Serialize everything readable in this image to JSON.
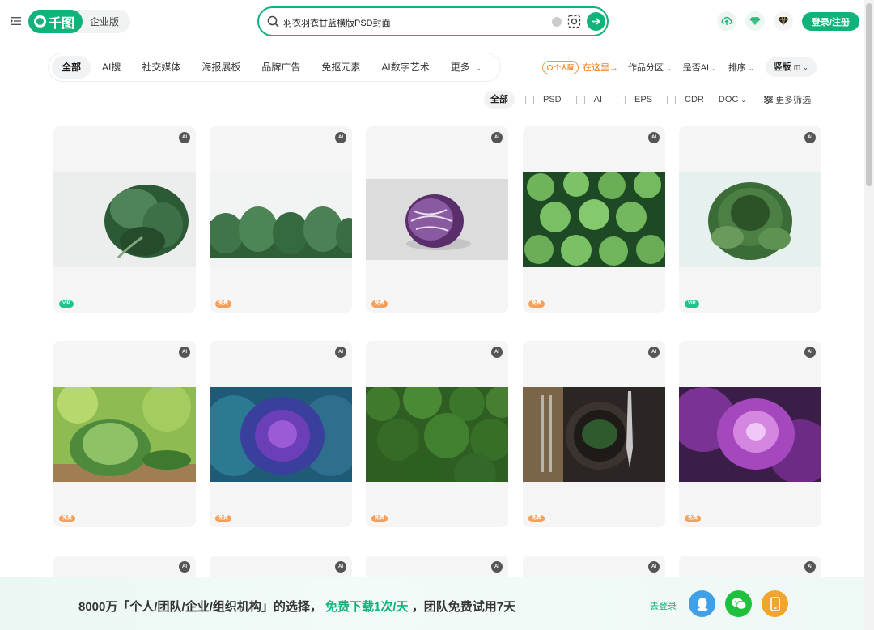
{
  "header": {
    "logo_text": "千图",
    "enterprise_label": "企业版",
    "search": {
      "value": "羽衣羽衣甘蓝横版PSD封面",
      "placeholder": "搜索"
    },
    "login_label": "登录/注册"
  },
  "categories": [
    {
      "label": "全部",
      "active": true
    },
    {
      "label": "AI搜",
      "active": false
    },
    {
      "label": "社交媒体",
      "active": false
    },
    {
      "label": "海报展板",
      "active": false
    },
    {
      "label": "品牌广告",
      "active": false
    },
    {
      "label": "免抠元素",
      "active": false
    },
    {
      "label": "AI数字艺术",
      "active": false
    },
    {
      "label": "更多",
      "active": false
    }
  ],
  "right_filters": {
    "personal_badge": "个人版",
    "here_text": "在这里→",
    "section": "作品分区",
    "is_ai": "是否AI",
    "sort": "排序",
    "orientation": "竖版"
  },
  "format_filter": {
    "all_label": "全部",
    "options": [
      "PSD",
      "AI",
      "EPS",
      "CDR"
    ],
    "doc_label": "DOC",
    "more_label": "更多筛选"
  },
  "cards": [
    {
      "image": "kale-bunch",
      "badge": "VIP",
      "ai_tag": "AI"
    },
    {
      "image": "kale-row",
      "badge": "免费",
      "ai_tag": "AI"
    },
    {
      "image": "red-cabbage-half",
      "badge": "免费",
      "ai_tag": "AI"
    },
    {
      "image": "cabbage-field",
      "badge": "免费",
      "ai_tag": "AI"
    },
    {
      "image": "savoy-cabbage",
      "badge": "VIP",
      "ai_tag": "AI"
    },
    {
      "image": "cabbage-bokeh",
      "badge": "免费",
      "ai_tag": "AI"
    },
    {
      "image": "purple-cabbage",
      "badge": "免费",
      "ai_tag": "AI"
    },
    {
      "image": "green-forest",
      "badge": "免费",
      "ai_tag": "AI"
    },
    {
      "image": "kale-plate",
      "badge": "免费",
      "ai_tag": "AI"
    },
    {
      "image": "ornamental-kale",
      "badge": "免费",
      "ai_tag": "AI"
    }
  ],
  "banner": {
    "text_1": "8000万「个人/团队/企业/组织机构」的选择，",
    "text_highlight": "免费下载1次/天",
    "text_2": "，团队免费试用7天",
    "login_label": "去登录"
  },
  "colors": {
    "accent": "#12b37a",
    "orange": "#f07e1b",
    "vip": "#1ec48c",
    "free": "#f5a05a"
  }
}
